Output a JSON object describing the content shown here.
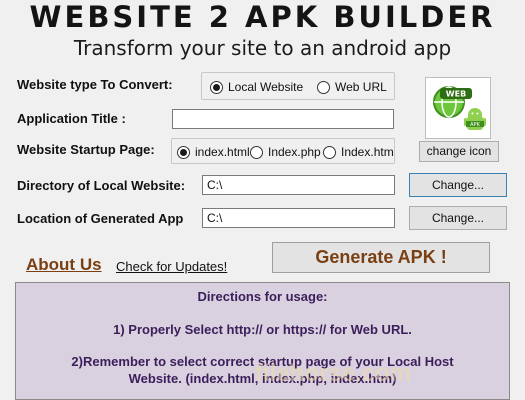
{
  "header": {
    "brand": "WEBSITE 2 APK BUILDER",
    "tagline": "Transform your site to an android app"
  },
  "form": {
    "website_type": {
      "label": "Website type To Convert:",
      "options": [
        "Local Website",
        "Web URL"
      ],
      "selected": "Local Website"
    },
    "app_title": {
      "label": "Application Title :",
      "value": ""
    },
    "startup_page": {
      "label": "Website Startup Page:",
      "options": [
        "index.html",
        "Index.php",
        "Index.htm"
      ],
      "selected": "index.html"
    },
    "local_dir": {
      "label": "Directory of Local Website:",
      "value": "C:\\",
      "button": "Change..."
    },
    "output_dir": {
      "label": "Location of Generated App",
      "value": "C:\\",
      "button": "Change..."
    }
  },
  "icon": {
    "badge_text": "WEB",
    "small_badge": "APK",
    "button": "change icon"
  },
  "actions": {
    "about": "About Us",
    "check_updates": "Check for Updates!",
    "generate": "Generate APK !"
  },
  "directions": {
    "title": "Directions for usage:",
    "step1": "1) Properly Select http:// or https:// for Web URL.",
    "step2": "2)Remember to select correct startup page of your Local Host Website.  (index.html, index.php, index.htm)"
  },
  "watermark": "filehorse.com",
  "colors": {
    "accent_brown": "#7a3f13",
    "panel_bg": "#d9d0e0",
    "panel_text": "#3c1f5a",
    "icon_green": "#5cb82a"
  }
}
